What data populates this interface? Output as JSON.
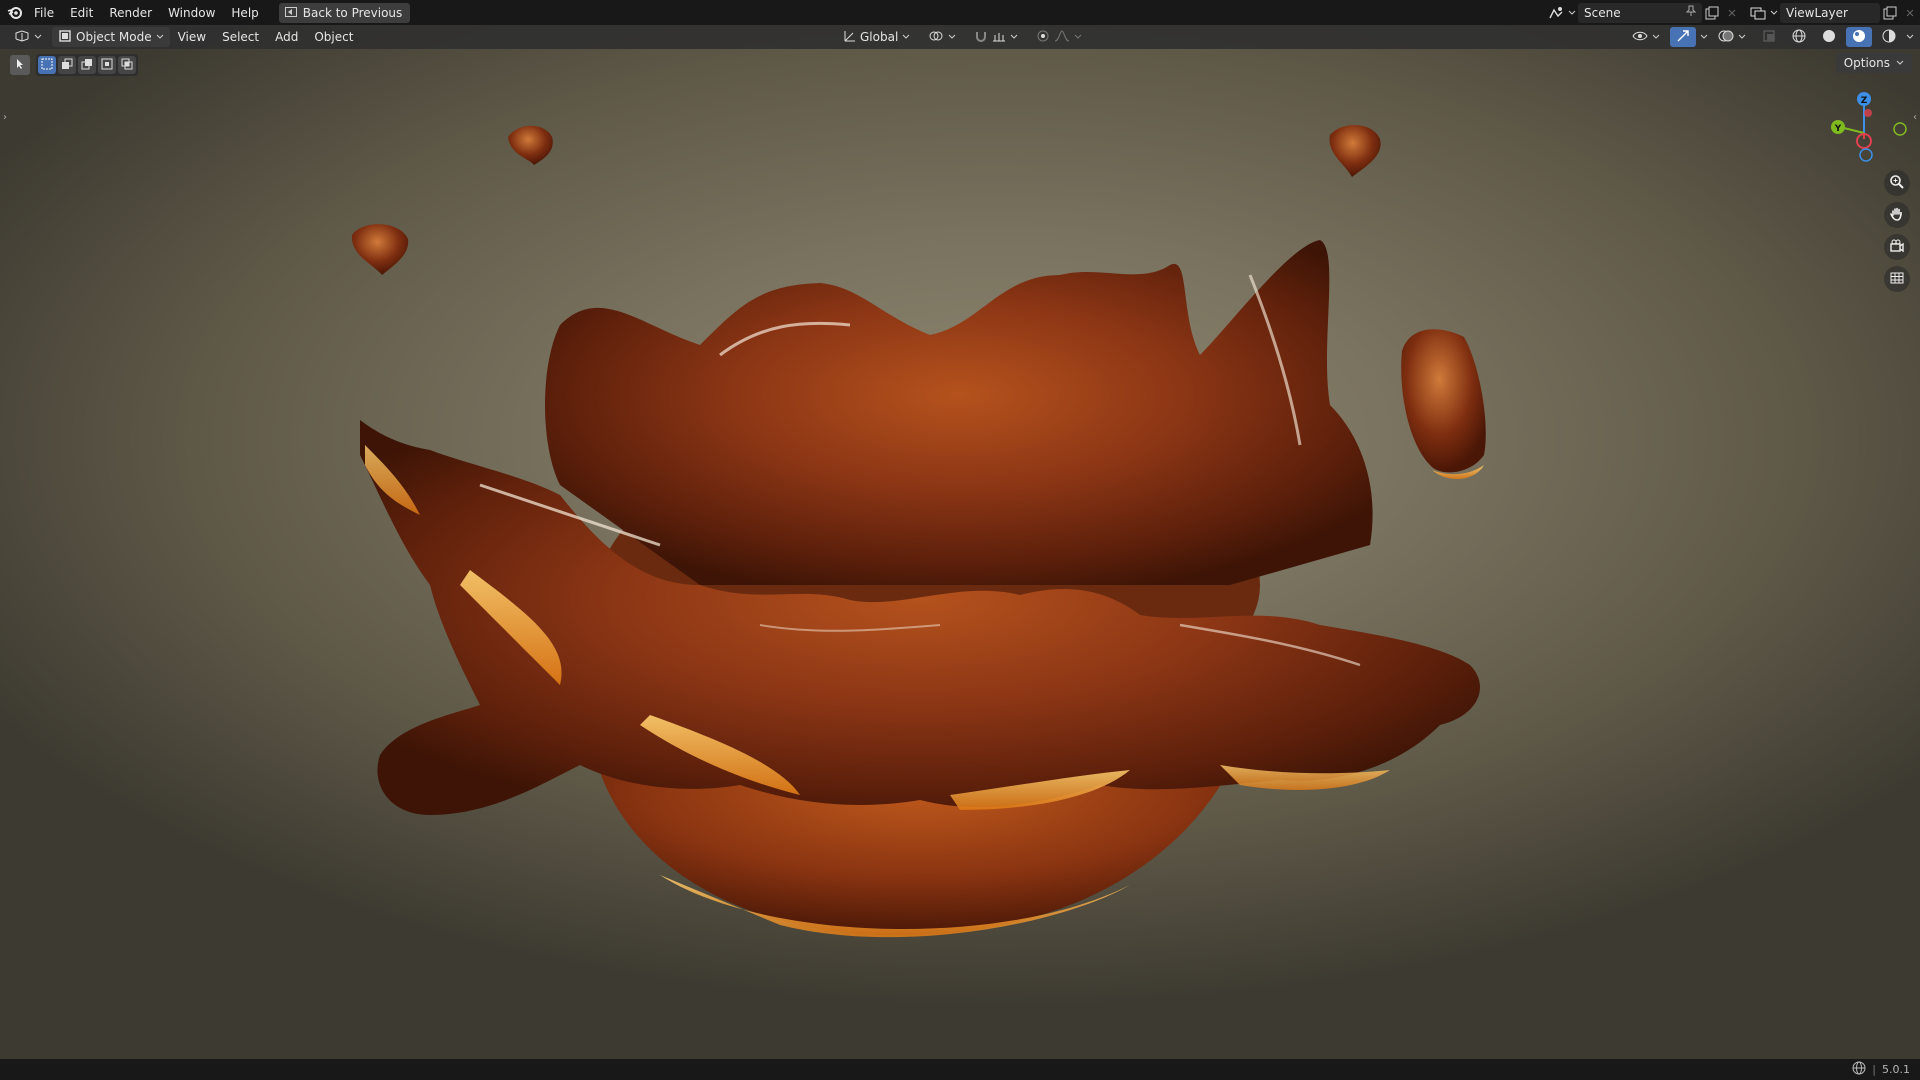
{
  "topbar": {
    "menus": [
      "File",
      "Edit",
      "Render",
      "Window",
      "Help"
    ],
    "back_label": "Back to Previous",
    "scene_name": "Scene",
    "view_layer": "ViewLayer"
  },
  "viewport_header": {
    "mode_label": "Object Mode",
    "menus": [
      "View",
      "Select",
      "Add",
      "Object"
    ],
    "transform_orientation": "Global",
    "options_label": "Options"
  },
  "gizmo": {
    "z_label": "Z",
    "y_label": "Y"
  },
  "status": {
    "version": "5.0.1"
  },
  "colors": {
    "accent": "#4772b3",
    "axis_x": "#e0414f",
    "axis_y": "#7fba1f",
    "axis_z": "#3d8ee5"
  }
}
